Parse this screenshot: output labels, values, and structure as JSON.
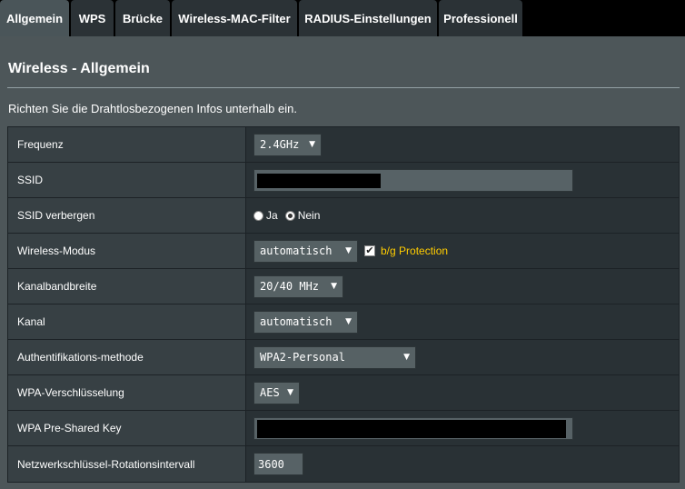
{
  "tabs": [
    {
      "label": "Allgemein",
      "active": true
    },
    {
      "label": "WPS"
    },
    {
      "label": "Brücke"
    },
    {
      "label": "Wireless-MAC-Filter"
    },
    {
      "label": "RADIUS-Einstellungen"
    },
    {
      "label": "Professionell"
    }
  ],
  "page": {
    "title": "Wireless - Allgemein",
    "description": "Richten Sie die Drahtlosbezogenen Infos unterhalb ein."
  },
  "settings": {
    "frequency": {
      "label": "Frequenz",
      "value": "2.4GHz"
    },
    "ssid": {
      "label": "SSID",
      "value": ""
    },
    "hide_ssid": {
      "label": "SSID verbergen",
      "option_yes": "Ja",
      "option_no": "Nein",
      "selected": "Nein"
    },
    "wireless_mode": {
      "label": "Wireless-Modus",
      "value": "automatisch",
      "protection_label": "b/g Protection",
      "protection_checked": true
    },
    "bandwidth": {
      "label": "Kanalbandbreite",
      "value": "20/40 MHz"
    },
    "channel": {
      "label": "Kanal",
      "value": "automatisch"
    },
    "auth_method": {
      "label": "Authentifikations-methode",
      "value": "WPA2-Personal"
    },
    "wpa_encryption": {
      "label": "WPA-Verschlüsselung",
      "value": "AES"
    },
    "psk": {
      "label": "WPA Pre-Shared Key",
      "value": ""
    },
    "rotation_interval": {
      "label": "Netzwerkschlüssel-Rotationsintervall",
      "value": "3600"
    }
  },
  "icons": {
    "dropdown": "▼",
    "check": "✔"
  },
  "colors": {
    "accent": "#ffcc00",
    "background": "#4d5659",
    "label_bg": "#374044",
    "field_bg": "#293135"
  }
}
